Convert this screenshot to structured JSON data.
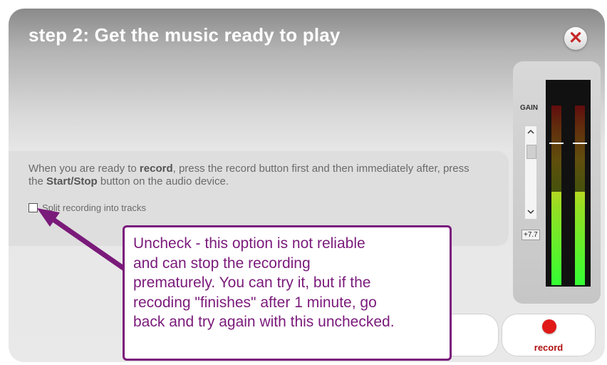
{
  "dialog": {
    "title": "step 2: Get the music ready to play",
    "close_label": "✕"
  },
  "instructions": {
    "part1": "When you are ready to ",
    "bold1": "record",
    "part2": ", press the record button first and then immediately after, press the ",
    "bold2": "Start/Stop",
    "part3": " button on the audio device."
  },
  "split_checkbox": {
    "label": "Split recording into tracks",
    "checked": false
  },
  "gain": {
    "label": "GAIN",
    "value": "+7.7",
    "up_icon": "^",
    "down_icon": "v"
  },
  "meter": {
    "left_level": 0.52,
    "right_level": 0.52
  },
  "record_button": {
    "label": "record",
    "color": "#e01818"
  },
  "callout": {
    "lines": [
      "Uncheck - this option is not reliable",
      "and can stop the recording",
      "prematurely.  You can try it, but if the",
      "recoding \"finishes\" after 1 minute, go",
      "back and try again with this unchecked."
    ],
    "color": "#7a1a7a"
  }
}
